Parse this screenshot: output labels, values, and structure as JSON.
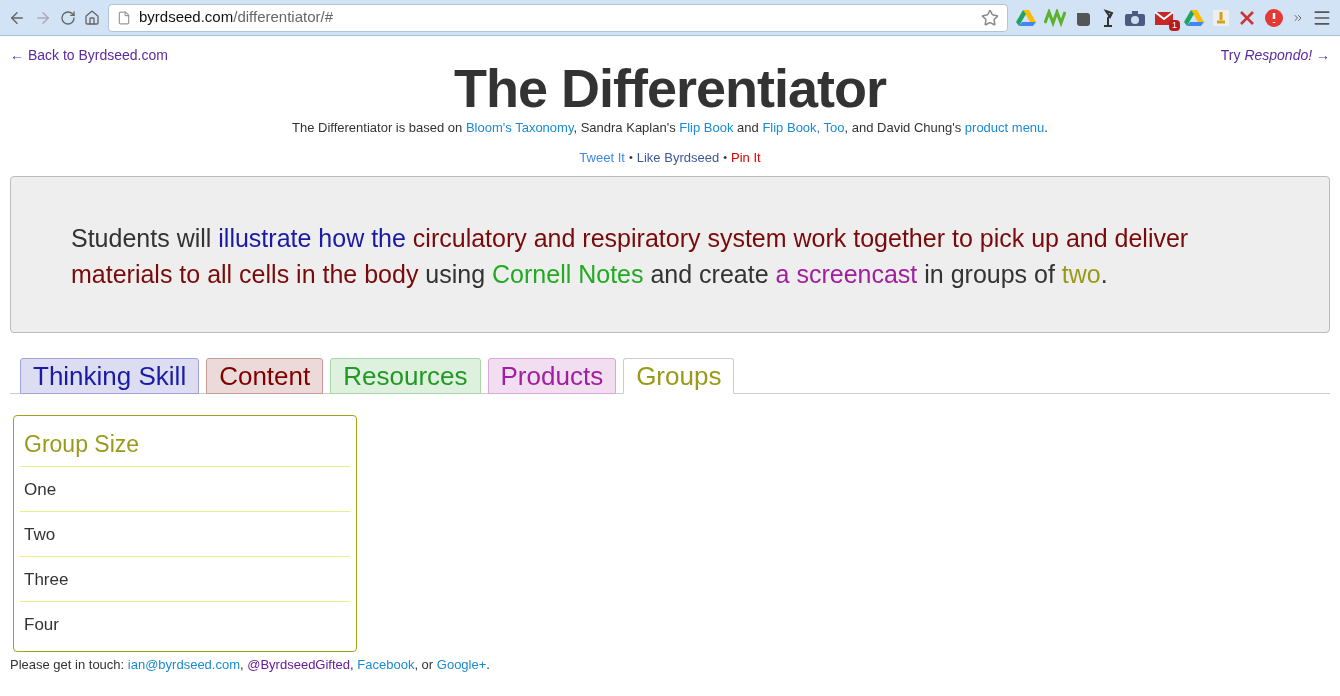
{
  "browser": {
    "url_host": "byrdseed.com",
    "url_path": "/differentiator/#",
    "mail_badge": "1"
  },
  "nav": {
    "back": "← Back to Byrdseed.com",
    "try": "Try *Respondo!* →"
  },
  "title": "The Differentiator",
  "intro": [
    {
      "kind": "text",
      "text": "The Differentiator is based on "
    },
    {
      "kind": "link",
      "text": "Bloom's Taxonomy"
    },
    {
      "kind": "text",
      "text": ", Sandra Kaplan's "
    },
    {
      "kind": "link",
      "text": "Flip Book"
    },
    {
      "kind": "text",
      "text": " and "
    },
    {
      "kind": "link",
      "text": "Flip Book, Too"
    },
    {
      "kind": "text",
      "text": ", and David Chung's "
    },
    {
      "kind": "link",
      "text": "product menu"
    },
    {
      "kind": "text",
      "text": "."
    }
  ],
  "share": [
    {
      "kind": "link",
      "text": "Tweet It",
      "color": "#3b8ae0"
    },
    {
      "kind": "sep",
      "text": "•"
    },
    {
      "kind": "link",
      "text": "Like Byrdseed",
      "color": "#3b5998"
    },
    {
      "kind": "sep",
      "text": "•"
    },
    {
      "kind": "link",
      "text": "Pin It",
      "color": "#dd0000"
    }
  ],
  "statement": [
    {
      "text": "Students will ",
      "color": "#333333"
    },
    {
      "text": "illustrate how the",
      "color": "#1a1aa6"
    },
    {
      "text": " circulatory and respiratory system work together to pick up and deliver materials to all cells in the body",
      "color": "#7a0a0a"
    },
    {
      "text": " using ",
      "color": "#333333"
    },
    {
      "text": "Cornell Notes",
      "color": "#22aa22"
    },
    {
      "text": " and create ",
      "color": "#333333"
    },
    {
      "text": "a screencast",
      "color": "#a020a0"
    },
    {
      "text": " in groups of ",
      "color": "#333333"
    },
    {
      "text": "two",
      "color": "#9a9a1a"
    },
    {
      "text": ".",
      "color": "#333333"
    }
  ],
  "tabs": [
    {
      "label": "Thinking Skill",
      "color": "#1a1aa6",
      "selected": false
    },
    {
      "label": "Content",
      "color": "#800000",
      "selected": false
    },
    {
      "label": "Resources",
      "color": "#229922",
      "selected": false
    },
    {
      "label": "Products",
      "color": "#a020a0",
      "selected": false
    },
    {
      "label": "Groups",
      "color": "#9a9a1a",
      "selected": true
    }
  ],
  "panel": {
    "title": "Group Size",
    "items": [
      "One",
      "Two",
      "Three",
      "Four"
    ]
  },
  "footer": [
    {
      "kind": "text",
      "text": "Please get in touch: "
    },
    {
      "kind": "link",
      "text": "ian@byrdseed.com"
    },
    {
      "kind": "text",
      "text": ", "
    },
    {
      "kind": "link",
      "text": "@ByrdseedGifted",
      "visited": true
    },
    {
      "kind": "text",
      "text": ", "
    },
    {
      "kind": "link",
      "text": "Facebook"
    },
    {
      "kind": "text",
      "text": ", or "
    },
    {
      "kind": "link",
      "text": "Google+"
    },
    {
      "kind": "text",
      "text": "."
    }
  ]
}
